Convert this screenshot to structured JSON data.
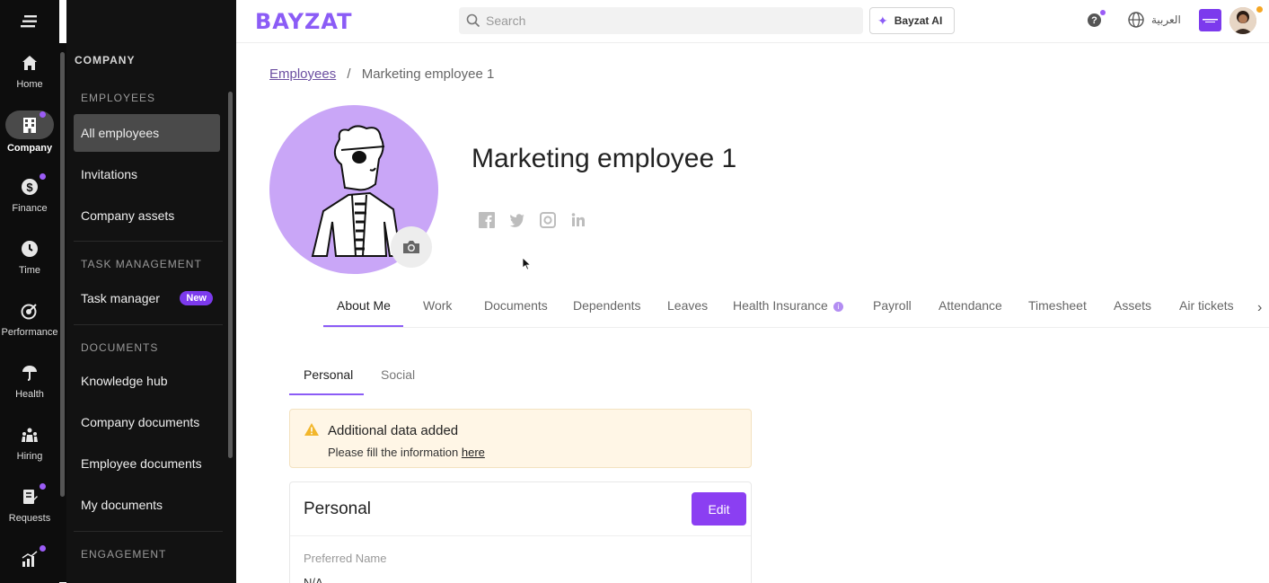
{
  "rail": {
    "items": [
      {
        "label": "Home",
        "icon": "home-icon"
      },
      {
        "label": "Company",
        "icon": "building-icon",
        "active": true,
        "dot": true
      },
      {
        "label": "Finance",
        "icon": "dollar-icon",
        "dot": true
      },
      {
        "label": "Time",
        "icon": "clock-icon"
      },
      {
        "label": "Performance",
        "icon": "target-icon"
      },
      {
        "label": "Health",
        "icon": "umbrella-icon"
      },
      {
        "label": "Hiring",
        "icon": "people-icon"
      },
      {
        "label": "Requests",
        "icon": "request-icon",
        "dot": true
      }
    ]
  },
  "submenu": {
    "heading": "COMPANY",
    "sections": {
      "employees": "EMPLOYEES",
      "task_management": "TASK MANAGEMENT",
      "documents": "DOCUMENTS",
      "engagement": "ENGAGEMENT"
    },
    "items": {
      "all_employees": "All employees",
      "invitations": "Invitations",
      "company_assets": "Company assets",
      "task_manager": "Task manager",
      "task_manager_badge": "New",
      "knowledge_hub": "Knowledge hub",
      "company_documents": "Company documents",
      "employee_documents": "Employee documents",
      "my_documents": "My documents"
    }
  },
  "topbar": {
    "logo": "BAYZAT",
    "search_placeholder": "Search",
    "ai_button": "Bayzat AI",
    "help": "?",
    "language": "العربية"
  },
  "breadcrumb": {
    "parent": "Employees",
    "separator": "/",
    "current": "Marketing employee 1"
  },
  "profile": {
    "name": "Marketing employee 1",
    "socials": [
      "facebook-icon",
      "twitter-icon",
      "instagram-icon",
      "linkedin-icon"
    ]
  },
  "tabs": [
    "About Me",
    "Work",
    "Documents",
    "Dependents",
    "Leaves",
    "Health Insurance",
    "Payroll",
    "Attendance",
    "Timesheet",
    "Assets",
    "Air tickets"
  ],
  "subtabs": [
    "Personal",
    "Social"
  ],
  "alert": {
    "title": "Additional data added",
    "message": "Please fill the information ",
    "link": "here"
  },
  "personal_card": {
    "title": "Personal",
    "edit_label": "Edit",
    "field_label": "Preferred Name",
    "field_value": "N/A"
  },
  "colors": {
    "accent": "#8b5cf6",
    "sidebar": "#121212",
    "rail": "#0d0d0d",
    "alert_bg": "#fff6e6"
  }
}
